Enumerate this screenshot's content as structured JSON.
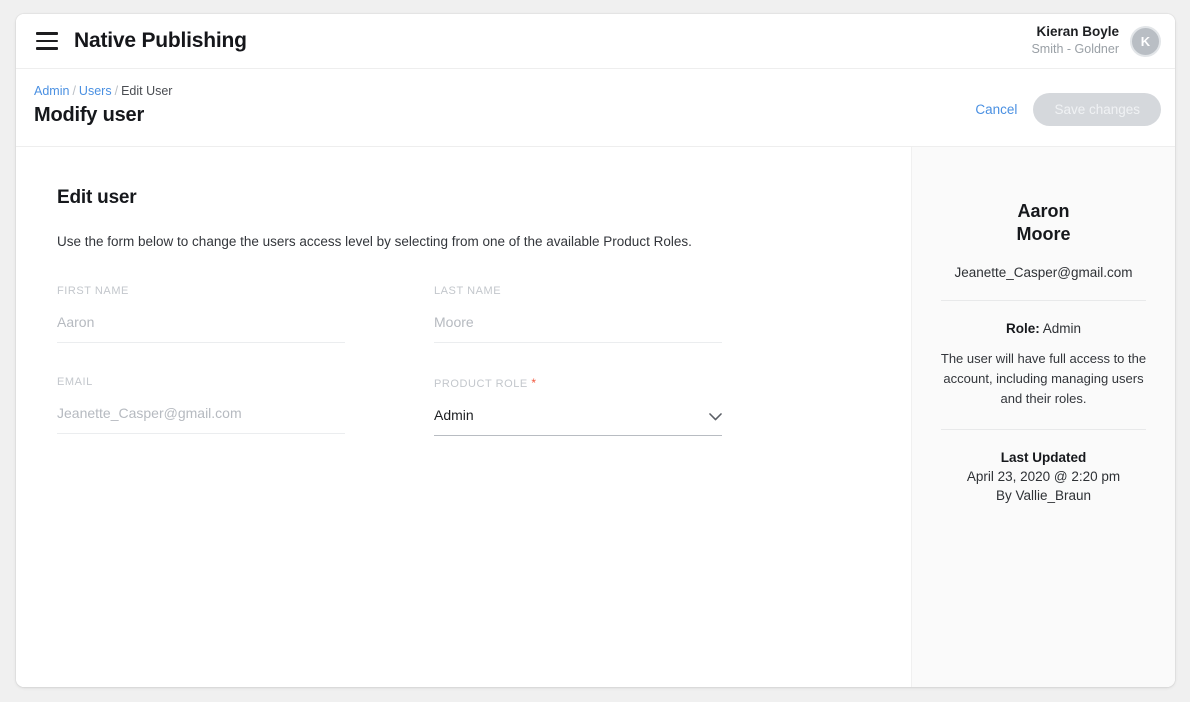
{
  "header": {
    "menu_icon": "hamburger-icon",
    "brand_title": "Native Publishing",
    "user_name": "Kieran Boyle",
    "user_org": "Smith - Goldner",
    "avatar_initial": "K"
  },
  "subheader": {
    "breadcrumb": {
      "admin": "Admin",
      "users": "Users",
      "current": "Edit User",
      "separator": "/"
    },
    "page_title": "Modify user",
    "cancel_label": "Cancel",
    "save_label": "Save changes",
    "save_disabled": true
  },
  "form": {
    "heading": "Edit user",
    "description": "Use the form below to change the users access level by selecting from one of the available Product Roles.",
    "fields": [
      {
        "label": "FIRST NAME",
        "value": "Aaron",
        "required": false,
        "type": "text"
      },
      {
        "label": "LAST NAME",
        "value": "Moore",
        "required": false,
        "type": "text"
      },
      {
        "label": "EMAIL",
        "value": "Jeanette_Casper@gmail.com",
        "required": false,
        "type": "text"
      },
      {
        "label": "PRODUCT ROLE",
        "value": "Admin",
        "required": true,
        "type": "select",
        "required_marker": "*"
      }
    ]
  },
  "side_panel": {
    "first_name": "Aaron",
    "last_name": "Moore",
    "email": "Jeanette_Casper@gmail.com",
    "role_label": "Role:",
    "role_value": "Admin",
    "role_description": "The user will have full access to the account, including managing users and their roles.",
    "last_updated_title": "Last Updated",
    "last_updated_date": "April 23, 2020 @ 2:20 pm",
    "last_updated_by": "By Vallie_Braun"
  },
  "colors": {
    "link_blue": "#4a90e2",
    "required_red": "#f2583e",
    "panel_bg": "#fafafa",
    "disabled_button": "#d5d8dc"
  }
}
